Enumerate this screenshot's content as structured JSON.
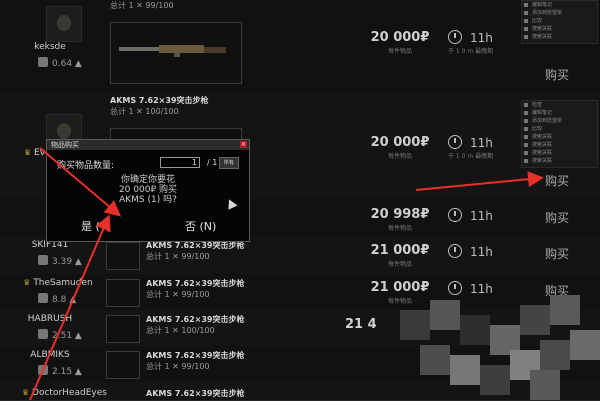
{
  "rows": [
    {
      "seller": "keksde",
      "rating": "0.64",
      "item_name": "",
      "total": "总计 1  ✕ 99/100",
      "price": "20 000₽",
      "price_sub": "每件物品",
      "time": "11h",
      "time_sub": "于 1 0 m 最晚期",
      "buy": "购买",
      "menu": true
    },
    {
      "seller": "Ev",
      "rating": "",
      "item_name": "AKMS 7.62×39突击步枪",
      "total": "总计 1  ✕ 100/100",
      "price": "20 000₽",
      "price_sub": "每件物品",
      "time": "11h",
      "time_sub": "于 1 0 m 最晚期",
      "buy": "购买",
      "menu": true
    },
    {
      "seller": "",
      "rating": "",
      "item_name": "",
      "total": "",
      "price": "20 998₽",
      "price_sub": "每件物品",
      "time": "11h",
      "time_sub": "",
      "buy": "购买",
      "menu": false
    },
    {
      "seller": "SKIF141",
      "rating": "3.39",
      "item_name": "AKMS 7.62×39突击步枪",
      "total": "总计 1  ✕ 99/100",
      "price": "21 000₽",
      "price_sub": "每件物品",
      "time": "11h",
      "time_sub": "",
      "buy": "购买",
      "menu": false
    },
    {
      "seller": "TheSamuden",
      "rating": "8.8",
      "item_name": "AKMS 7.62×39突击步枪",
      "total": "总计 1  ✕ 99/100",
      "price": "21 000₽",
      "price_sub": "每件物品",
      "time": "11h",
      "time_sub": "",
      "buy": "购买",
      "menu": false
    },
    {
      "seller": "HABRUSH",
      "rating": "2.51",
      "item_name": "AKMS 7.62×39突击步枪",
      "total": "总计 1  ✕ 100/100",
      "price": "21 4",
      "price_sub": "",
      "time": "",
      "time_sub": "",
      "buy": "",
      "menu": false
    },
    {
      "seller": "ALBMIKS",
      "rating": "2.15",
      "item_name": "AKMS 7.62×39突击步枪",
      "total": "总计 1  ✕ 99/100",
      "price": "",
      "price_sub": "",
      "time": "",
      "time_sub": "",
      "buy": "",
      "menu": false
    },
    {
      "seller": "DoctorHeadEyes",
      "rating": "",
      "item_name": "AKMS 7.62×39突击步枪",
      "total": "",
      "price": "",
      "price_sub": "",
      "time": "",
      "time_sub": "",
      "buy": "",
      "menu": false
    }
  ],
  "menu_items": [
    "检查",
    "编辑笔记",
    "添加到愿望单",
    "比较",
    "搜索关联",
    "搜索关联",
    "搜索关联",
    "搜索关联"
  ],
  "dialog": {
    "title": "物品购买",
    "close": "×",
    "qty_label": "购买物品数量:",
    "qty_value": "1",
    "qty_max": "/ 1",
    "all_label": "所有",
    "confirm_line1": "你确定你要花",
    "confirm_line2": "20 000₽ 购买",
    "confirm_line3": "AKMS (1) 吗?",
    "yes": "是 (Y)",
    "no": "否 (N)"
  },
  "colors": {
    "bg": "#0d0d0d",
    "arrow": "#e8302a",
    "text": "#bfbfbf"
  }
}
